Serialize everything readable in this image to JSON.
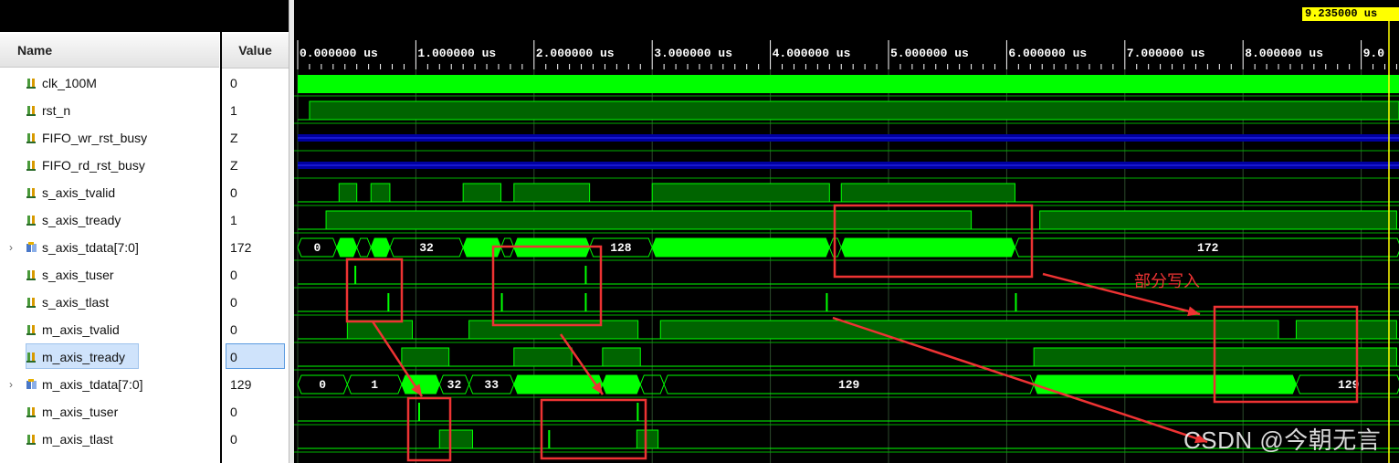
{
  "columns": {
    "name": "Name",
    "value": "Value"
  },
  "signals": [
    {
      "name": "clk_100M",
      "value": "0",
      "kind": "bit",
      "expandable": false
    },
    {
      "name": "rst_n",
      "value": "1",
      "kind": "bit",
      "expandable": false
    },
    {
      "name": "FIFO_wr_rst_busy",
      "value": "Z",
      "kind": "bit",
      "expandable": false
    },
    {
      "name": "FIFO_rd_rst_busy",
      "value": "Z",
      "kind": "bit",
      "expandable": false
    },
    {
      "name": "s_axis_tvalid",
      "value": "0",
      "kind": "bit",
      "expandable": false
    },
    {
      "name": "s_axis_tready",
      "value": "1",
      "kind": "bit",
      "expandable": false
    },
    {
      "name": "s_axis_tdata[7:0]",
      "value": "172",
      "kind": "bus",
      "expandable": true
    },
    {
      "name": "s_axis_tuser",
      "value": "0",
      "kind": "bit",
      "expandable": false
    },
    {
      "name": "s_axis_tlast",
      "value": "0",
      "kind": "bit",
      "expandable": false
    },
    {
      "name": "m_axis_tvalid",
      "value": "0",
      "kind": "bit",
      "expandable": false
    },
    {
      "name": "m_axis_tready",
      "value": "0",
      "kind": "bit",
      "expandable": false,
      "selected": true
    },
    {
      "name": "m_axis_tdata[7:0]",
      "value": "129",
      "kind": "bus",
      "expandable": true
    },
    {
      "name": "m_axis_tuser",
      "value": "0",
      "kind": "bit",
      "expandable": false
    },
    {
      "name": "m_axis_tlast",
      "value": "0",
      "kind": "bit",
      "expandable": false
    }
  ],
  "timeline": {
    "unit": "us",
    "ticks": [
      "0.000000 us",
      "1.000000 us",
      "2.000000 us",
      "3.000000 us",
      "4.000000 us",
      "5.000000 us",
      "6.000000 us",
      "7.000000 us",
      "8.000000 us",
      "9.0"
    ],
    "cursor_time": "9.235000 us"
  },
  "bus_labels": {
    "s_axis_tdata": [
      "0",
      "32",
      "128",
      "172"
    ],
    "m_axis_tdata": [
      "0",
      "1",
      "32",
      "33",
      "129",
      "129"
    ]
  },
  "annotation": {
    "text": "部分写入"
  },
  "watermark": "CSDN @今朝无言",
  "colors": {
    "wave_green": "#00ff00",
    "wave_dark_green": "#006400",
    "grid_line": "#00b000",
    "highz_blue": "#0000a0",
    "annotation_red": "#ee3333",
    "cursor_yellow": "#ffff00",
    "selection_blue": "#cfe3fb"
  },
  "icons": {
    "bit_signal": "signal-bit-icon",
    "bus_signal": "signal-bus-icon",
    "expand": "chevron-right-icon"
  }
}
